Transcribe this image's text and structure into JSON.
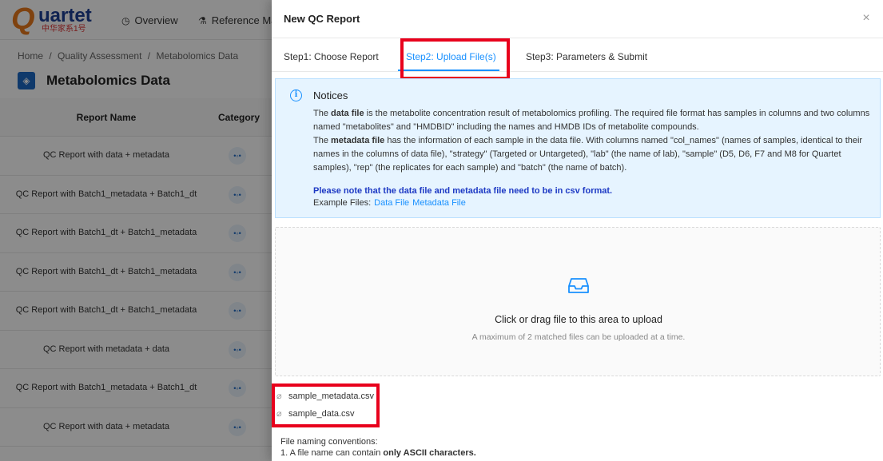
{
  "app": {
    "logo_word": "uartet",
    "logo_letter": "Q",
    "logo_sub": "中华家系1号",
    "nav": [
      {
        "label": "Overview",
        "icon": "clock-icon"
      },
      {
        "label": "Reference Mate",
        "icon": "flask-icon"
      }
    ],
    "breadcrumb": [
      "Home",
      "/",
      "Quality Assessment",
      "/",
      "Metabolomics Data"
    ],
    "page_title": "Metabolomics Data",
    "table": {
      "columns": [
        "Report Name",
        "Category"
      ],
      "rows": [
        "QC Report with data + metadata",
        "QC Report with Batch1_metadata + Batch1_dt",
        "QC Report with Batch1_dt + Batch1_metadata",
        "QC Report with Batch1_dt + Batch1_metadata",
        "QC Report with Batch1_dt + Batch1_metadata",
        "QC Report with metadata + data",
        "QC Report with Batch1_metadata + Batch1_dt",
        "QC Report with data + metadata"
      ]
    }
  },
  "drawer": {
    "title": "New QC Report",
    "close": "×",
    "tabs": [
      "Step1: Choose Report",
      "Step2: Upload File(s)",
      "Step3: Parameters & Submit"
    ],
    "active_tab": 1,
    "notice": {
      "title": "Notices",
      "p1_pre": "The ",
      "p1_bold": "data file",
      "p1_post": " is the metabolite concentration result of metabolomics profiling. The required file format has samples in columns and two columns named \"metabolites\" and \"HMDBID\" including the names and HMDB IDs of metabolite compounds.",
      "p2_pre": "The ",
      "p2_bold": "metadata file",
      "p2_post": " has the information of each sample in the data file. With columns named \"col_names\" (names of samples, identical to their names in the columns of data file), \"strategy\" (Targeted or Untargeted), \"lab\" (the name of lab), \"sample\" (D5, D6, F7 and M8 for Quartet samples), \"rep\" (the replicates for each sample) and \"batch\" (the name of batch).",
      "note": "Please note that the data file and metadata file need to be in csv format.",
      "examples_label": "Example Files:",
      "example_links": [
        "Data File",
        "Metadata File"
      ]
    },
    "upload": {
      "text": "Click or drag file to this area to upload",
      "hint": "A maximum of 2 matched files can be uploaded at a time."
    },
    "files": [
      "sample_metadata.csv",
      "sample_data.csv"
    ],
    "conventions": {
      "heading": "File naming conventions:",
      "rule1_pre": "1. A file name can contain ",
      "rule1_bold": "only ASCII characters."
    }
  },
  "colors": {
    "accent": "#1890ff",
    "highlight": "#e8001c",
    "notice_bg": "#e6f4ff"
  }
}
